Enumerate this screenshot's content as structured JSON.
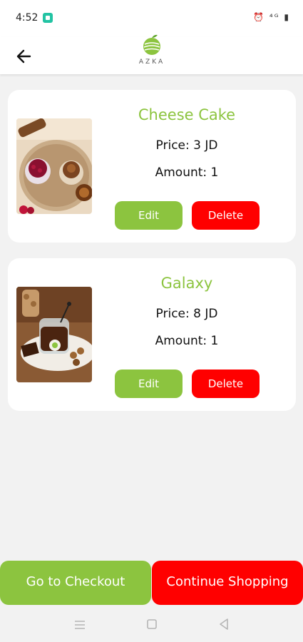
{
  "status_bar": {
    "time": "4:52",
    "icons": "⏰ ⁴ᴳ ▮"
  },
  "header": {
    "logo_text": "AZKA"
  },
  "cart_items": [
    {
      "name": "Cheese Cake",
      "price": "Price: 3 JD",
      "amount": "Amount: 1",
      "edit_label": "Edit",
      "delete_label": "Delete"
    },
    {
      "name": "Galaxy",
      "price": "Price: 8 JD",
      "amount": "Amount: 1",
      "edit_label": "Edit",
      "delete_label": "Delete"
    }
  ],
  "bottom": {
    "checkout_label": "Go to Checkout",
    "continue_label": "Continue Shopping"
  },
  "colors": {
    "accent_green": "#8cc43f",
    "delete_red": "#ff0000",
    "background": "#f2f2f2"
  }
}
